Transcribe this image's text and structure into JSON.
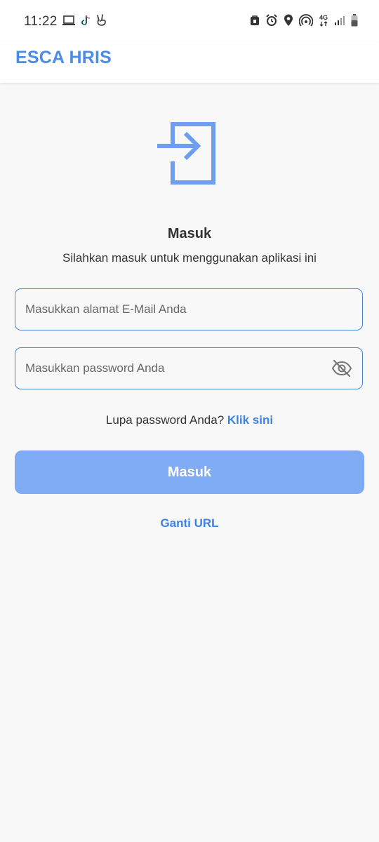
{
  "status_bar": {
    "time": "11:22",
    "left_icons": [
      "laptop-icon",
      "tiktok-icon",
      "peace-hand-icon"
    ],
    "right_icons": [
      "lock-notification-icon",
      "alarm-icon",
      "location-icon",
      "hotspot-icon",
      "network-4g-icon",
      "signal-icon",
      "battery-icon"
    ],
    "network_label": "4G"
  },
  "app_bar": {
    "title": "ESCA HRIS"
  },
  "login": {
    "icon": "login-icon",
    "heading": "Masuk",
    "subheading": "Silahkan masuk untuk menggunakan aplikasi ini",
    "email": {
      "value": "",
      "placeholder": "Masukkan alamat E-Mail Anda"
    },
    "password": {
      "value": "",
      "placeholder": "Masukkan password Anda",
      "toggle_icon": "eye-off-icon"
    },
    "forgot_prompt": "Lupa password Anda?",
    "forgot_link": "Klik sini",
    "submit_label": "Masuk",
    "change_url_label": "Ganti URL"
  },
  "colors": {
    "brand": "#4a8ce8",
    "link": "#3c82e3",
    "button": "#7fabf4",
    "field_border": "#4a85d8",
    "background": "#f8f8f9"
  }
}
